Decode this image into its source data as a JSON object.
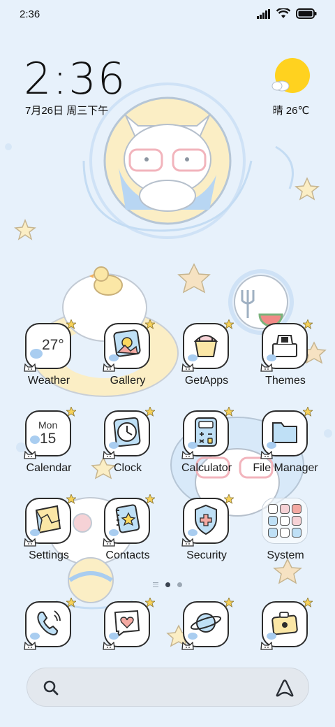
{
  "status": {
    "time": "2:36",
    "icons": [
      "signal-icon",
      "wifi-icon",
      "battery-icon"
    ]
  },
  "clock_widget": {
    "time": "2:36",
    "date": "7月26日 周三下午"
  },
  "weather_widget": {
    "temp": "晴 26℃",
    "icon": "sun-cloud-icon"
  },
  "apps": [
    {
      "label": "Weather",
      "icon": "weather-icon",
      "icon_text": "27°"
    },
    {
      "label": "Gallery",
      "icon": "gallery-icon"
    },
    {
      "label": "GetApps",
      "icon": "getapps-icon"
    },
    {
      "label": "Themes",
      "icon": "themes-icon"
    },
    {
      "label": "Calendar",
      "icon": "calendar-icon",
      "icon_day": "Mon",
      "icon_date": "15"
    },
    {
      "label": "Clock",
      "icon": "clock-icon"
    },
    {
      "label": "Calculator",
      "icon": "calculator-icon"
    },
    {
      "label": "File Manager",
      "icon": "folder-icon"
    },
    {
      "label": "Settings",
      "icon": "settings-icon"
    },
    {
      "label": "Contacts",
      "icon": "contacts-icon"
    },
    {
      "label": "Security",
      "icon": "shield-icon"
    },
    {
      "label": "System",
      "icon": "system-folder-icon"
    }
  ],
  "dock": [
    {
      "icon": "phone-icon"
    },
    {
      "icon": "messages-icon"
    },
    {
      "icon": "browser-icon"
    },
    {
      "icon": "camera-icon"
    }
  ],
  "pager": {
    "pages": 2,
    "current": 1
  },
  "search": {
    "left_icon": "search-icon",
    "right_icon": "assistant-icon"
  },
  "colors": {
    "background": "#e7f1fb",
    "icon_outline": "#2c2c2c",
    "star": "#f7d25a",
    "accent_blue": "#a9cdf0",
    "accent_yellow": "#fbe7a6",
    "sun": "#ffd21f"
  }
}
